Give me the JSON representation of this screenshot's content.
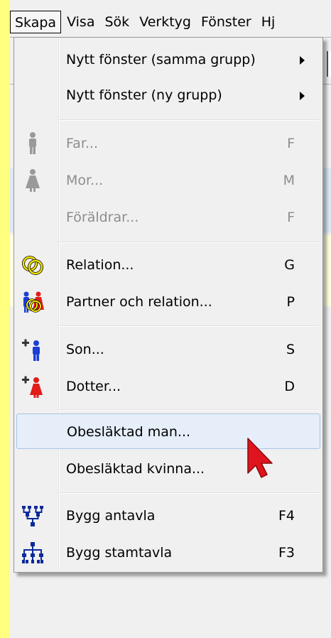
{
  "menubar": {
    "items": [
      "Skapa",
      "Visa",
      "Sök",
      "Verktyg",
      "Fönster",
      "Hj"
    ]
  },
  "menu": {
    "items": [
      {
        "label": "Nytt fönster (samma grupp)",
        "shortcut": "",
        "submenu": true,
        "enabled": true
      },
      {
        "label": "Nytt fönster (ny grupp)",
        "shortcut": "",
        "submenu": true,
        "enabled": true
      },
      {
        "label": "Far...",
        "shortcut": "F",
        "icon": "father-icon",
        "enabled": false
      },
      {
        "label": "Mor...",
        "shortcut": "M",
        "icon": "mother-icon",
        "enabled": false
      },
      {
        "label": "Föräldrar...",
        "shortcut": "F",
        "enabled": false
      },
      {
        "label": "Relation...",
        "shortcut": "G",
        "icon": "rings-icon",
        "enabled": true
      },
      {
        "label": "Partner och relation...",
        "shortcut": "P",
        "icon": "couple-rings-icon",
        "enabled": true
      },
      {
        "label": "Son...",
        "shortcut": "S",
        "icon": "add-son-icon",
        "enabled": true
      },
      {
        "label": "Dotter...",
        "shortcut": "D",
        "icon": "add-daughter-icon",
        "enabled": true
      },
      {
        "label": "Obesläktad man...",
        "shortcut": "",
        "enabled": true,
        "hovered": true
      },
      {
        "label": "Obesläktad kvinna...",
        "shortcut": "",
        "enabled": true
      },
      {
        "label": "Bygg antavla",
        "shortcut": "F4",
        "icon": "ancestor-tree-icon",
        "enabled": true
      },
      {
        "label": "Bygg stamtavla",
        "shortcut": "F3",
        "icon": "descendant-tree-icon",
        "enabled": true
      }
    ]
  },
  "colors": {
    "male": "#1a3fd6",
    "female": "#e21b1b",
    "disabled_icon": "#9a9a9a",
    "hover_bg": "#e5eef9",
    "cursor": "#e0141e"
  }
}
